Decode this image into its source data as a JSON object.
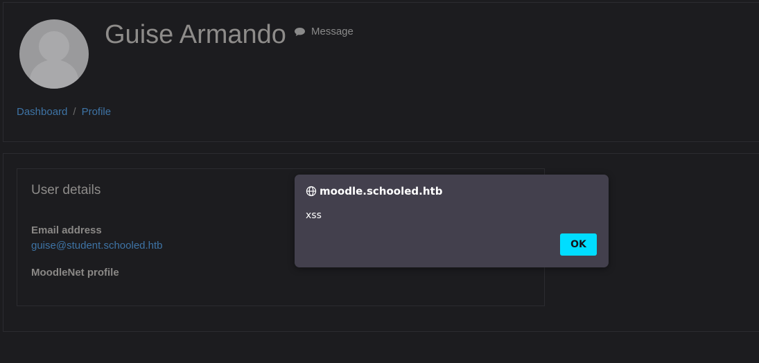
{
  "profile": {
    "name": "Guise Armando",
    "message_label": "Message"
  },
  "breadcrumb": {
    "items": [
      "Dashboard",
      "Profile"
    ],
    "separator": "/"
  },
  "user_details": {
    "title": "User details",
    "fields": [
      {
        "label": "Email address",
        "value": "guise@student.schooled.htb"
      },
      {
        "label": "MoodleNet profile",
        "value": ""
      }
    ]
  },
  "alert": {
    "origin": "moodle.schooled.htb",
    "message": "xss",
    "ok_label": "OK"
  },
  "colors": {
    "background": "#1c1c1f",
    "link": "#3e74a6",
    "dialog_bg": "#43404d",
    "ok_button": "#00ddff"
  },
  "icons": {
    "message": "speech-bubble-icon",
    "origin": "globe-icon",
    "avatar": "default-user-avatar"
  }
}
